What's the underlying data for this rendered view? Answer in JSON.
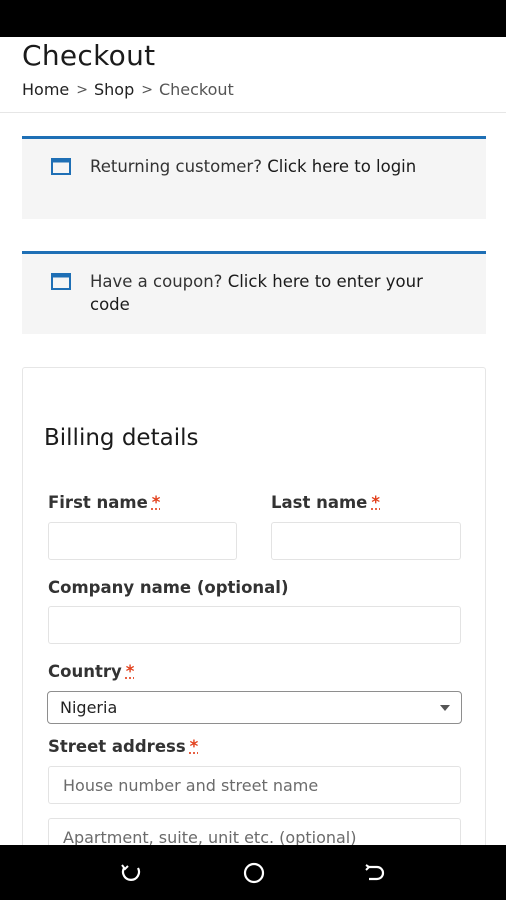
{
  "header": {
    "title": "Checkout",
    "breadcrumb": [
      {
        "label": "Home"
      },
      {
        "label": "Shop"
      },
      {
        "label": "Checkout"
      }
    ],
    "breadcrumb_separator": ">"
  },
  "notices": [
    {
      "icon": "window-icon",
      "prefix": "Returning customer?",
      "link": "Click here to login"
    },
    {
      "icon": "window-icon",
      "prefix": "Have a coupon?",
      "link": "Click here to enter your code"
    }
  ],
  "billing": {
    "title": "Billing details",
    "required_mark": "*",
    "first_name": {
      "label": "First name",
      "value": ""
    },
    "last_name": {
      "label": "Last name",
      "value": ""
    },
    "company": {
      "label": "Company name (optional)",
      "value": ""
    },
    "country": {
      "label": "Country",
      "selected": "Nigeria"
    },
    "street": {
      "label": "Street address",
      "line1_placeholder": "House number and street name",
      "line2_placeholder": "Apartment, suite, unit etc. (optional)"
    }
  },
  "colors": {
    "notice_accent": "#1e6fb5",
    "required": "#e2401c"
  },
  "system_nav": {
    "buttons": [
      "recents-icon",
      "home-icon",
      "back-icon"
    ]
  }
}
